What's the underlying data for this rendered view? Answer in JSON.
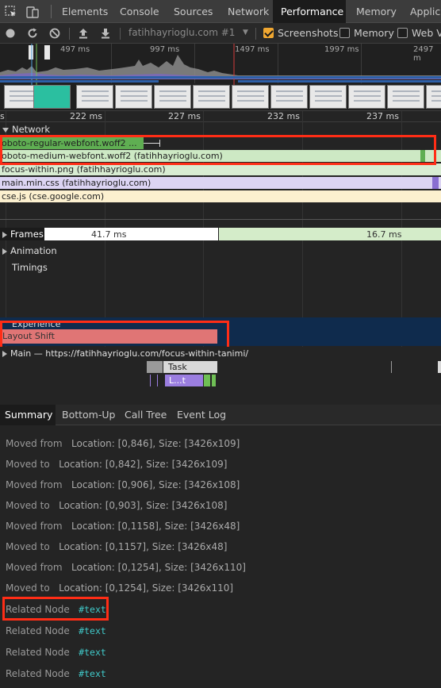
{
  "tabs": [
    {
      "label": "Elements"
    },
    {
      "label": "Console"
    },
    {
      "label": "Sources"
    },
    {
      "label": "Network"
    },
    {
      "label": "Performance",
      "active": true
    },
    {
      "label": "Memory"
    },
    {
      "label": "Applica"
    }
  ],
  "toolbar": {
    "profile": "fatihhayrioglu.com #1",
    "screenshots_label": "Screenshots",
    "screenshots_checked": true,
    "memory_label": "Memory",
    "memory_checked": false,
    "webvitals_label": "Web Vi",
    "webvitals_checked": false
  },
  "overview": {
    "ticks": [
      "497 ms",
      "997 ms",
      "1497 ms",
      "1997 ms",
      "2497 m"
    ]
  },
  "ruler": {
    "left_fragment": "s",
    "ticks": [
      "222 ms",
      "227 ms",
      "232 ms",
      "237 ms"
    ]
  },
  "network": {
    "label": "Network",
    "requests": [
      {
        "label": "oboto-regular-webfont.woff2 ...",
        "color": "#5fae52"
      },
      {
        "label": "oboto-medium-webfont.woff2 (fatihhayrioglu.com)",
        "color": "#cde9c4"
      },
      {
        "label": "focus-within.png (fatihhayrioglu.com)",
        "color": "#d8ecd2"
      },
      {
        "label": "main.min.css (fatihhayrioglu.com)",
        "color": "#dcd4f3"
      },
      {
        "label": "cse.js (cse.google.com)",
        "color": "#fcf0cf"
      }
    ]
  },
  "frames": {
    "label": "Frames",
    "first": "41.7 ms",
    "second": "16.7 ms"
  },
  "animation_label": "Animation",
  "timings_label": "Timings",
  "experience": {
    "label": "Experience",
    "layout_shift": "Layout Shift"
  },
  "main": {
    "label": "Main — https://fatihhayrioglu.com/focus-within-tanimi/",
    "task_label": "Task",
    "sub_label": "L...t"
  },
  "bottom_tabs": [
    {
      "label": "Summary",
      "active": true
    },
    {
      "label": "Bottom-Up"
    },
    {
      "label": "Call Tree"
    },
    {
      "label": "Event Log"
    }
  ],
  "summary": {
    "rows": [
      {
        "key": "Moved from",
        "value": "Location: [0,846], Size: [3426x109]"
      },
      {
        "key": "Moved to",
        "value": "Location: [0,842], Size: [3426x109]"
      },
      {
        "key": "Moved from",
        "value": "Location: [0,906], Size: [3426x108]"
      },
      {
        "key": "Moved to",
        "value": "Location: [0,903], Size: [3426x108]"
      },
      {
        "key": "Moved from",
        "value": "Location: [0,1158], Size: [3426x48]"
      },
      {
        "key": "Moved to",
        "value": "Location: [0,1157], Size: [3426x48]"
      },
      {
        "key": "Moved from",
        "value": "Location: [0,1254], Size: [3426x110]"
      },
      {
        "key": "Moved to",
        "value": "Location: [0,1254], Size: [3426x110]"
      }
    ],
    "nodes": [
      {
        "key": "Related Node",
        "value": "#text"
      },
      {
        "key": "Related Node",
        "value": "#text"
      },
      {
        "key": "Related Node",
        "value": "#text"
      },
      {
        "key": "Related Node",
        "value": "#text"
      }
    ]
  }
}
